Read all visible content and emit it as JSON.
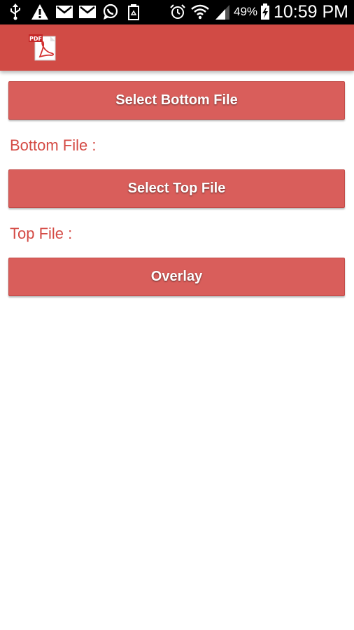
{
  "status_bar": {
    "icons": [
      "usb-icon",
      "warning-icon",
      "gmail-icon",
      "gmail-icon",
      "whatsapp-icon",
      "recycle-icon",
      "alarm-icon",
      "wifi-icon",
      "signal-icon",
      "battery-charging-icon"
    ],
    "battery_percent": "49%",
    "time": "10:59 PM"
  },
  "app_bar": {
    "logo": "pdf-file-icon",
    "logo_text": "PDF",
    "color": "#d14b45"
  },
  "main": {
    "select_bottom_label": "Select Bottom File",
    "bottom_file_label": "Bottom File :",
    "select_top_label": "Select Top File",
    "top_file_label": "Top File :",
    "overlay_label": "Overlay",
    "button_color": "#d95e5b",
    "label_color": "#d44a44"
  }
}
